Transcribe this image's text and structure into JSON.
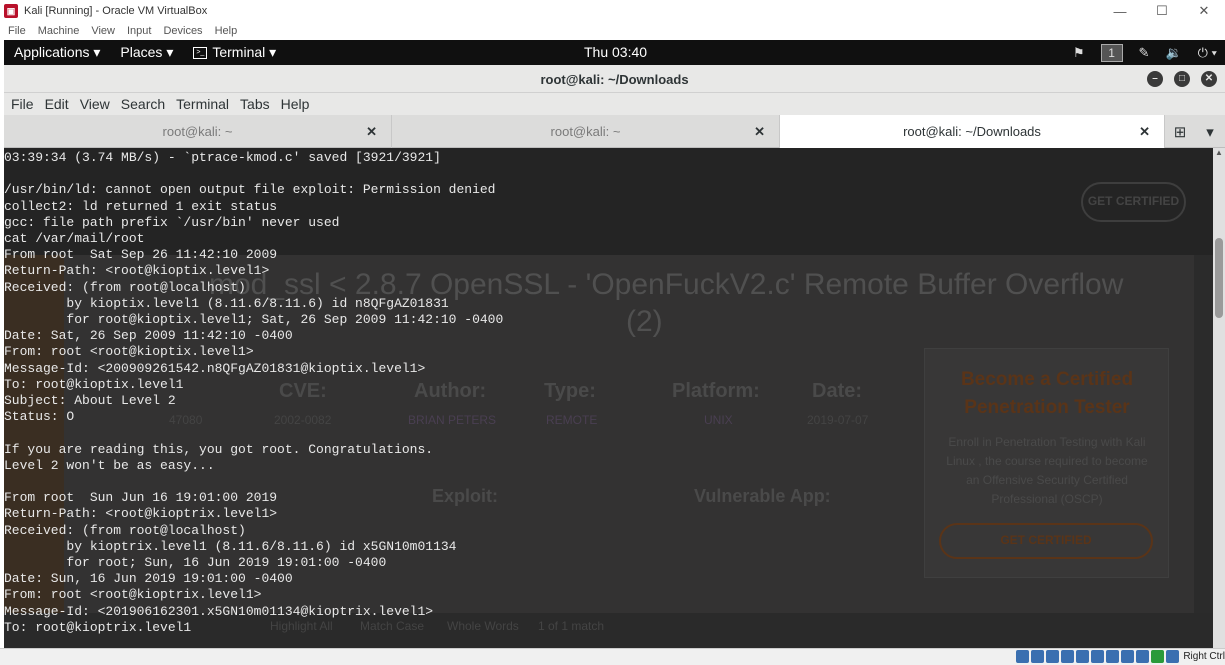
{
  "vbox": {
    "title": "Kali [Running] - Oracle VM VirtualBox",
    "menu": [
      "File",
      "Machine",
      "View",
      "Input",
      "Devices",
      "Help"
    ],
    "host_key": "Right Ctrl"
  },
  "kali_topbar": {
    "applications": "Applications ▾",
    "places": "Places ▾",
    "terminal": "Terminal ▾",
    "clock": "Thu 03:40",
    "workspace": "1"
  },
  "terminal": {
    "title": "root@kali: ~/Downloads",
    "menu": [
      "File",
      "Edit",
      "View",
      "Search",
      "Terminal",
      "Tabs",
      "Help"
    ],
    "tabs": [
      {
        "label": "root@kali: ~"
      },
      {
        "label": "root@kali: ~"
      },
      {
        "label": "root@kali: ~/Downloads"
      }
    ],
    "output": [
      "03:39:34 (3.74 MB/s) - `ptrace-kmod.c' saved [3921/3921]",
      "",
      "/usr/bin/ld: cannot open output file exploit: Permission denied",
      "collect2: ld returned 1 exit status",
      "gcc: file path prefix `/usr/bin' never used",
      "cat /var/mail/root",
      "From root  Sat Sep 26 11:42:10 2009",
      "Return-Path: <root@kioptix.level1>",
      "Received: (from root@localhost)",
      "        by kioptix.level1 (8.11.6/8.11.6) id n8QFgAZ01831",
      "        for root@kioptix.level1; Sat, 26 Sep 2009 11:42:10 -0400",
      "Date: Sat, 26 Sep 2009 11:42:10 -0400",
      "From: root <root@kioptix.level1>",
      "Message-Id: <200909261542.n8QFgAZ01831@kioptix.level1>",
      "To: root@kioptix.level1",
      "Subject: About Level 2",
      "Status: O",
      "",
      "If you are reading this, you got root. Congratulations.",
      "Level 2 won't be as easy...",
      "",
      "From root  Sun Jun 16 19:01:00 2019",
      "Return-Path: <root@kioptrix.level1>",
      "Received: (from root@localhost)",
      "        by kioptrix.level1 (8.11.6/8.11.6) id x5GN10m01134",
      "        for root; Sun, 16 Jun 2019 19:01:00 -0400",
      "Date: Sun, 16 Jun 2019 19:01:00 -0400",
      "From: root <root@kioptrix.level1>",
      "Message-Id: <201906162301.x5GN10m01134@kioptrix.level1>",
      "To: root@kioptrix.level1"
    ]
  },
  "background_page": {
    "heading_line1": "mod_ssl < 2.8.7 OpenSSL - 'OpenFuckV2.c' Remote Buffer Overflow",
    "heading_line2": "(2)",
    "cve_label": "CVE:",
    "cve_value": "2002-0082",
    "author_label": "Author:",
    "author_value": "BRIAN PETERS",
    "type_label": "Type:",
    "type_value": "REMOTE",
    "platform_label": "Platform:",
    "platform_value": "UNIX",
    "date_label": "Date:",
    "date_value": "2019-07-07",
    "id_value": "47080",
    "exploit_label": "Exploit:",
    "vuln_label": "Vulnerable App:",
    "get_certified": "GET CERTIFIED",
    "promo_title": "Become a Certified Penetration Tester",
    "promo_text": "Enroll in Penetration Testing with Kali Linux , the course required to become an Offensive Security Certified Professional (OSCP)",
    "promo_button": "GET CERTIFIED",
    "find_highlight": "Highlight All",
    "find_match_case": "Match Case",
    "find_whole_words": "Whole Words",
    "find_result": "1 of 1 match"
  }
}
